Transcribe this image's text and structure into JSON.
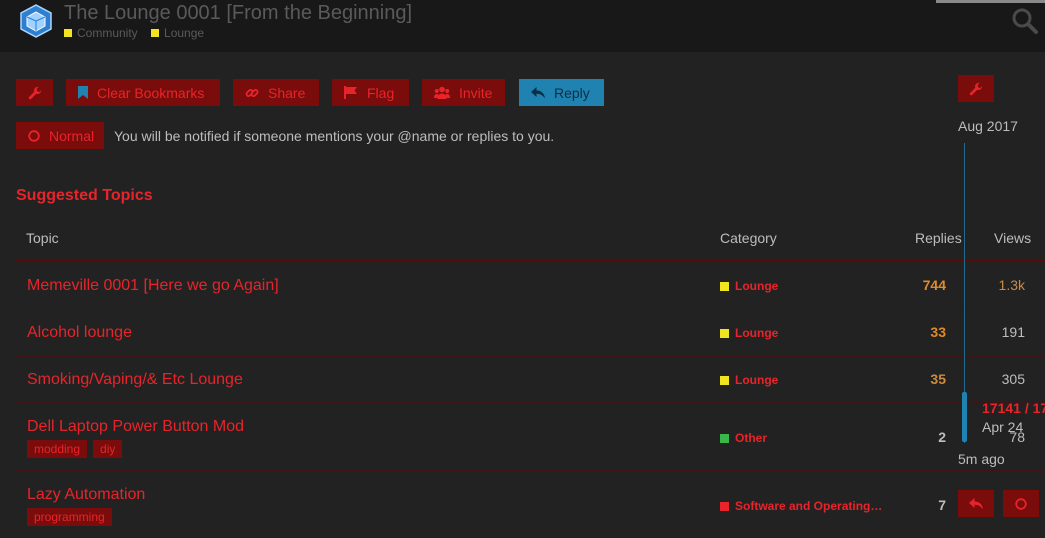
{
  "header": {
    "topic_title": "The Lounge 0001 [From the Beginning]",
    "breadcrumbs": [
      {
        "label": "Community",
        "color": "#f2e51f"
      },
      {
        "label": "Lounge",
        "color": "#f2e51f"
      }
    ],
    "icons": {
      "logo": "cube-logo-icon",
      "search": "search-icon"
    }
  },
  "actions": {
    "wrench_icon": "wrench-icon",
    "clear_bookmarks": "Clear Bookmarks",
    "share": "Share",
    "flag": "Flag",
    "invite": "Invite",
    "reply": "Reply"
  },
  "notifications": {
    "level": "Normal",
    "description": "You will be notified if someone mentions your @name or replies to you."
  },
  "suggested": {
    "title": "Suggested Topics",
    "columns": {
      "topic": "Topic",
      "category": "Category",
      "replies": "Replies",
      "views": "Views"
    },
    "rows": [
      {
        "title": "Memeville 0001 [Here we go Again]",
        "tags": [],
        "category": "Lounge",
        "category_color": "#f2e51f",
        "replies": "744",
        "replies_color": "#e08a2a",
        "views": "1.3k",
        "views_color": "#c78a4a"
      },
      {
        "title": "Alcohol lounge",
        "tags": [],
        "category": "Lounge",
        "category_color": "#f2e51f",
        "replies": "33",
        "replies_color": "#e08a2a",
        "views": "191",
        "views_color": "#bdbdbd"
      },
      {
        "title": "Smoking/Vaping/& Etc Lounge",
        "tags": [],
        "category": "Lounge",
        "category_color": "#f2e51f",
        "replies": "35",
        "replies_color": "#d08a3a",
        "views": "305",
        "views_color": "#bdbdbd"
      },
      {
        "title": "Dell Laptop Power Button Mod",
        "tags": [
          "modding",
          "diy"
        ],
        "category": "Other",
        "category_color": "#3ab54a",
        "replies": "2",
        "replies_color": "#bdbdbd",
        "views": "78",
        "views_color": "#bdbdbd"
      },
      {
        "title": "Lazy Automation",
        "tags": [
          "programming"
        ],
        "category": "Software and Operating…",
        "category_color": "#e8242a",
        "replies": "7",
        "replies_color": "#bdbdbd",
        "views": "",
        "views_color": "#bdbdbd"
      }
    ]
  },
  "timeline": {
    "start_date": "Aug 2017",
    "position": "17141 / 17",
    "current_date": "Apr 24",
    "last_activity": "5m ago"
  },
  "colors": {
    "accent": "#e8242a",
    "button_bg": "#7a0c0c",
    "reply_bg": "#1f82b0"
  }
}
